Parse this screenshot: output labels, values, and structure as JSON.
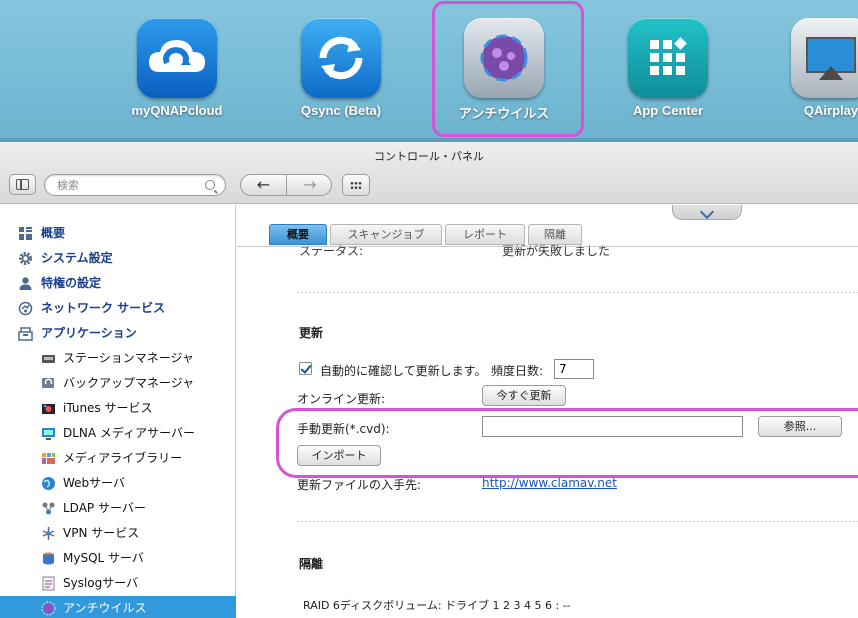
{
  "apps": [
    {
      "label": "myQNAPcloud",
      "icon": "cloud-icon"
    },
    {
      "label": "Qsync (Beta)",
      "icon": "sync-icon"
    },
    {
      "label": "アンチウイルス",
      "icon": "antivirus-icon"
    },
    {
      "label": "App Center",
      "icon": "app-grid-icon"
    },
    {
      "label": "QAirplay",
      "icon": "airplay-icon"
    }
  ],
  "window": {
    "title": "コントロール・パネル"
  },
  "toolbar": {
    "search_placeholder": "検索",
    "back": "←",
    "forward": "→"
  },
  "sidebar": {
    "items": [
      {
        "label": "概要",
        "level": 1,
        "icon": "overview-icon"
      },
      {
        "label": "システム設定",
        "level": 1,
        "icon": "gear-icon"
      },
      {
        "label": "特権の設定",
        "level": 1,
        "icon": "user-icon"
      },
      {
        "label": "ネットワーク サービス",
        "level": 1,
        "icon": "network-icon"
      },
      {
        "label": "アプリケーション",
        "level": 1,
        "icon": "applications-icon"
      },
      {
        "label": "ステーションマネージャ",
        "level": 2,
        "icon": "station-icon"
      },
      {
        "label": "バックアップマネージャ",
        "level": 2,
        "icon": "backup-icon"
      },
      {
        "label": "iTunes サービス",
        "level": 2,
        "icon": "itunes-icon"
      },
      {
        "label": "DLNA メディアサーバー",
        "level": 2,
        "icon": "dlna-icon"
      },
      {
        "label": "メディアライブラリー",
        "level": 2,
        "icon": "media-library-icon"
      },
      {
        "label": "Webサーバ",
        "level": 2,
        "icon": "web-icon"
      },
      {
        "label": "LDAP サーバー",
        "level": 2,
        "icon": "ldap-icon"
      },
      {
        "label": "VPN サービス",
        "level": 2,
        "icon": "vpn-icon"
      },
      {
        "label": "MySQL サーバ",
        "level": 2,
        "icon": "mysql-icon"
      },
      {
        "label": "Syslogサーバ",
        "level": 2,
        "icon": "syslog-icon"
      },
      {
        "label": "アンチウイルス",
        "level": 2,
        "icon": "antivirus-icon",
        "active": true
      }
    ]
  },
  "tabs": [
    "概要",
    "スキャンジョブ",
    "レポート",
    "隔離"
  ],
  "status": {
    "label": "ステータス:",
    "value": "更新が失敗しました"
  },
  "update": {
    "heading": "更新",
    "auto_check_label": "自動的に確認して更新します。",
    "auto_check": true,
    "frequency_label": "頻度日数:",
    "frequency_value": "7",
    "online_label": "オンライン更新:",
    "update_now": "今すぐ更新",
    "manual_label": "手動更新(*.cvd):",
    "manual_value": "",
    "browse": "参照...",
    "import": "インポート",
    "source_label": "更新ファイルの入手先:",
    "source_link": "http://www.clamav.net"
  },
  "quarantine": {
    "heading": "隔離",
    "raid_text": "RAID 6ディスクボリューム: ドライブ 1 2 3 4 5 6 : --"
  },
  "colors": {
    "highlight": "#d653d6",
    "active_item": "#3399dd",
    "link": "#1a55b8"
  }
}
